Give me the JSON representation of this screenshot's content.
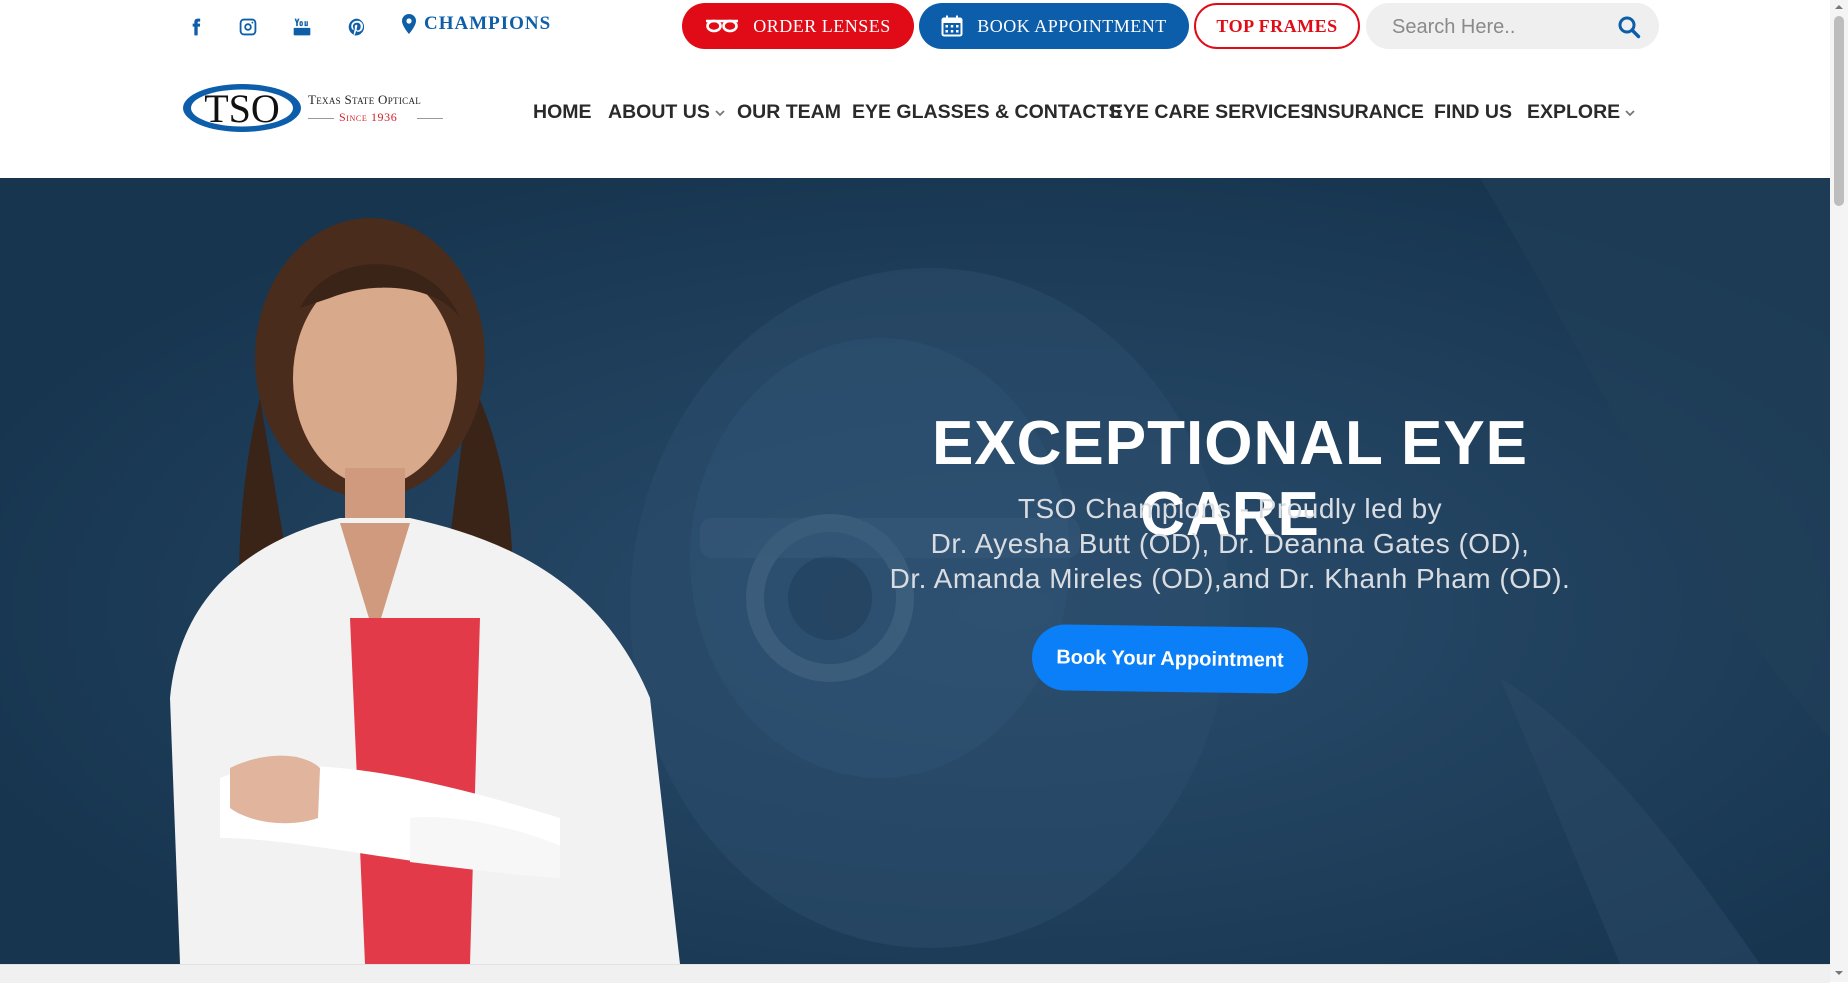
{
  "topbar": {
    "social": [
      {
        "name": "facebook-icon"
      },
      {
        "name": "instagram-icon"
      },
      {
        "name": "youtube-icon"
      },
      {
        "name": "pinterest-icon"
      }
    ],
    "location_label": "CHAMPIONS",
    "buttons": {
      "order_lenses": "ORDER LENSES",
      "book_appointment": "BOOK APPOINTMENT",
      "top_frames": "TOP FRAMES"
    },
    "search": {
      "placeholder": "Search Here.."
    }
  },
  "logo": {
    "mark": "TSO",
    "line1": "Texas State Optical",
    "line2": "Since 1936"
  },
  "nav": {
    "items": [
      {
        "label": "HOME"
      },
      {
        "label": "ABOUT US"
      },
      {
        "label": "OUR TEAM"
      },
      {
        "label": "EYE GLASSES & CONTACTS"
      },
      {
        "label": "EYE CARE SERVICES"
      },
      {
        "label": "INSURANCE"
      },
      {
        "label": "FIND US"
      },
      {
        "label": "EXPLORE"
      }
    ]
  },
  "hero": {
    "title": "EXCEPTIONAL EYE CARE",
    "subtitle_lines": [
      "TSO Champions - Proudly led by",
      "Dr. Ayesha Butt (OD), Dr. Deanna Gates (OD),",
      "Dr. Amanda Mireles (OD),and Dr. Khanh Pham (OD)."
    ],
    "cta": "Book Your Appointment"
  },
  "colors": {
    "brand_blue": "#0c5eaa",
    "brand_red": "#e10b17",
    "hero_overlay": "#1c3c58",
    "cta_blue": "#0b7ff7"
  }
}
